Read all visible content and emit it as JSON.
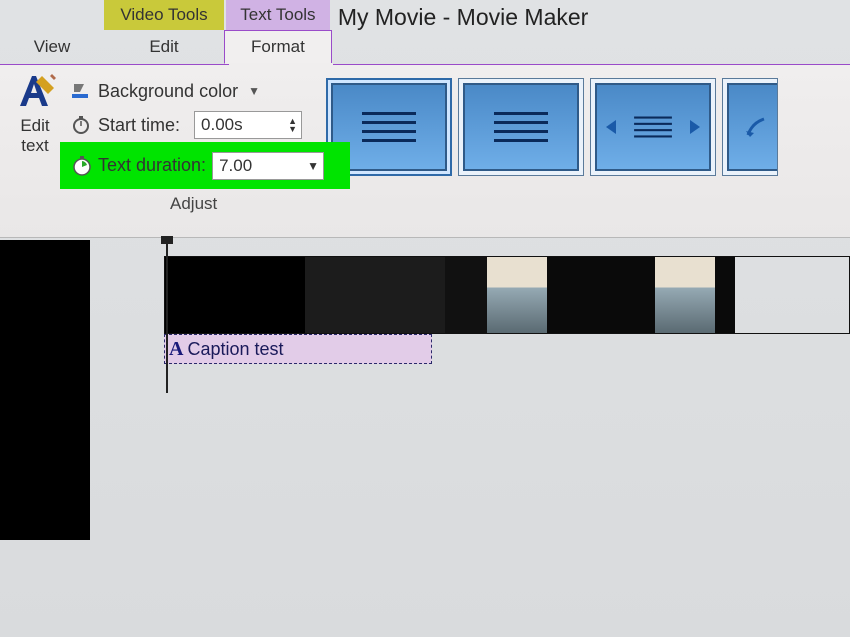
{
  "window": {
    "title": "My Movie - Movie Maker"
  },
  "tabs": {
    "view": "View",
    "edit": "Edit",
    "format": "Format",
    "video_tools": "Video Tools",
    "text_tools": "Text Tools"
  },
  "ribbon": {
    "edit_text": {
      "label": "Edit\ntext"
    },
    "bg_color": {
      "label": "Background color"
    },
    "start_time": {
      "label": "Start time:",
      "value": "0.00s"
    },
    "text_duration": {
      "label": "Text duration:",
      "value": "7.00"
    },
    "adjust_caption": "Adjust"
  },
  "timeline": {
    "caption_text": "Caption test"
  }
}
